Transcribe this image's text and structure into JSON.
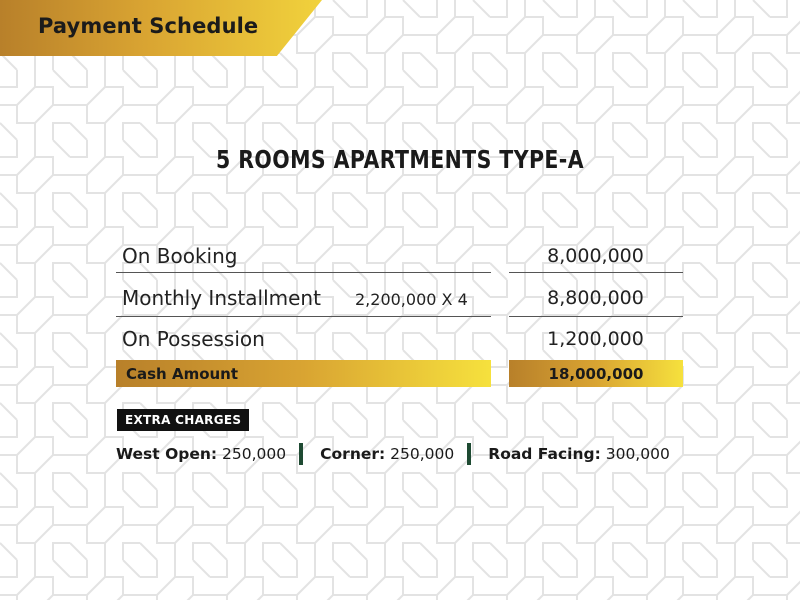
{
  "header": {
    "title": "Payment Schedule"
  },
  "heading": "5 ROOMS APARTMENTS TYPE-A",
  "schedule": {
    "rows": [
      {
        "label": "On Booking",
        "note": "",
        "amount": "8,000,000"
      },
      {
        "label": "Monthly  Installment",
        "note": "2,200,000 X 4",
        "amount": "8,800,000"
      },
      {
        "label": "On Possession",
        "note": "",
        "amount": "1,200,000"
      }
    ],
    "total": {
      "label": "Cash Amount",
      "amount": "18,000,000"
    }
  },
  "extra": {
    "title": "EXTRA CHARGES",
    "items": [
      {
        "name": "West Open:",
        "value": "250,000"
      },
      {
        "name": "Corner:",
        "value": "250,000"
      },
      {
        "name": "Road Facing:",
        "value": "300,000"
      }
    ]
  },
  "colors": {
    "gold_dark": "#b8802a",
    "gold_light": "#f6e13d",
    "separator_green": "#1e4a32",
    "badge_black": "#111111"
  }
}
